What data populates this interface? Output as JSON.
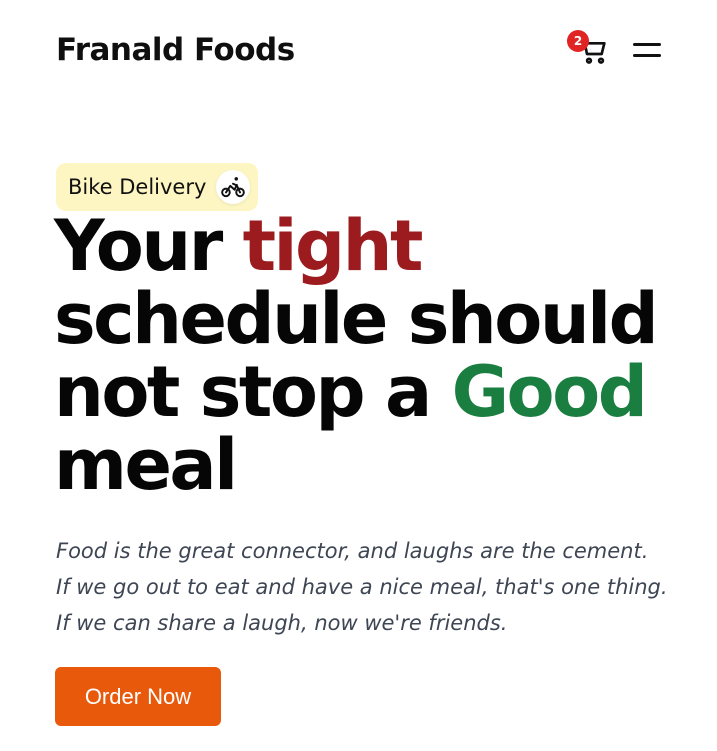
{
  "header": {
    "brand": "Franald Foods",
    "cart_count": "2",
    "cart_icon": "shopping-cart-icon",
    "menu_icon": "hamburger-menu-icon"
  },
  "hero": {
    "tag_label": "Bike Delivery",
    "tag_icon": "bicycle-rider-icon",
    "headline": {
      "part1": "Your ",
      "accent1": "tight",
      "part2": " schedule should not stop a ",
      "accent2": "Good",
      "part3": " meal"
    },
    "intro_lines": [
      "Food is the great connector, and laughs are the cement.",
      "If we go out to eat and have a nice meal, that's one thing.",
      "If we can share a laugh, now we're friends."
    ],
    "cta_label": "Order Now"
  },
  "colors": {
    "accent_red": "#9c1b1f",
    "accent_green": "#1a7e40",
    "cta_orange": "#e8590c",
    "tag_bg": "#fdf6c3",
    "badge_red": "#e02424"
  }
}
